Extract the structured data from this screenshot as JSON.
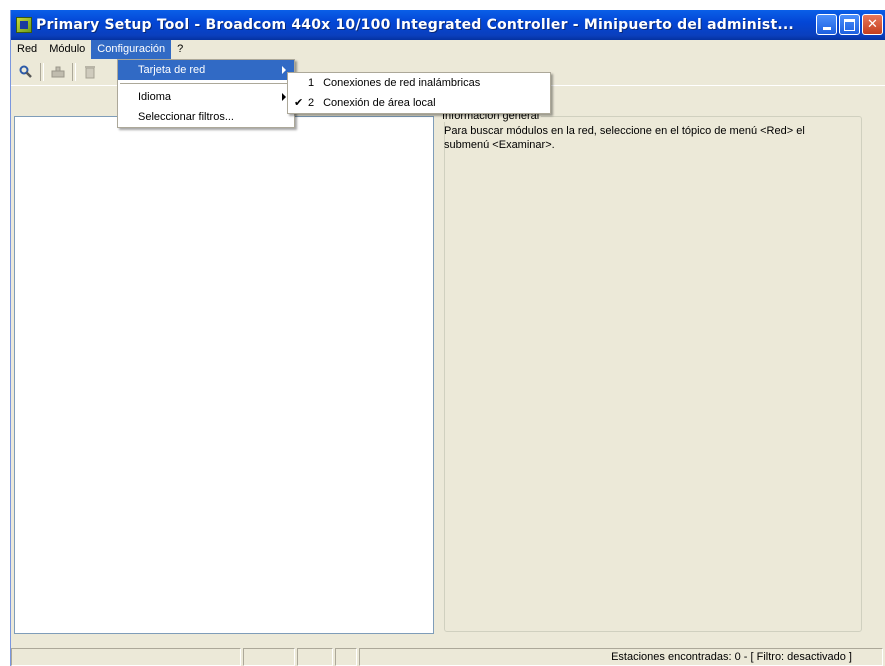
{
  "window": {
    "title": "Primary Setup Tool - Broadcom 440x 10/100 Integrated Controller - Minipuerto del administ...",
    "icon": "app-icon"
  },
  "menubar": {
    "items": [
      {
        "label": "Red"
      },
      {
        "label": "Módulo"
      },
      {
        "label": "Configuración"
      },
      {
        "label": "?"
      }
    ]
  },
  "config_menu": {
    "items": [
      {
        "label": "Tarjeta de red",
        "has_submenu": true
      },
      {
        "label": "Idioma",
        "has_submenu": true
      },
      {
        "label": "Seleccionar filtros..."
      }
    ]
  },
  "network_submenu": {
    "items": [
      {
        "number": "1",
        "label": "Conexiones de red inalámbricas",
        "checked": false
      },
      {
        "number": "2",
        "label": "Conexión de área local",
        "checked": true
      }
    ]
  },
  "toolbar": {
    "buttons": [
      "search-icon",
      "module-icon",
      "delete-icon"
    ]
  },
  "info": {
    "legend": "Información general",
    "body": "Para buscar módulos en la red, seleccione en el tópico de menú <Red> el submenú <Examinar>."
  },
  "statusbar": {
    "stations_text": "Estaciones encontradas: 0 - [ Filtro: desactivado ]"
  },
  "colors": {
    "highlight": "#316ac5",
    "window_bg": "#ece9d8",
    "titlebar": "#0346d6"
  }
}
